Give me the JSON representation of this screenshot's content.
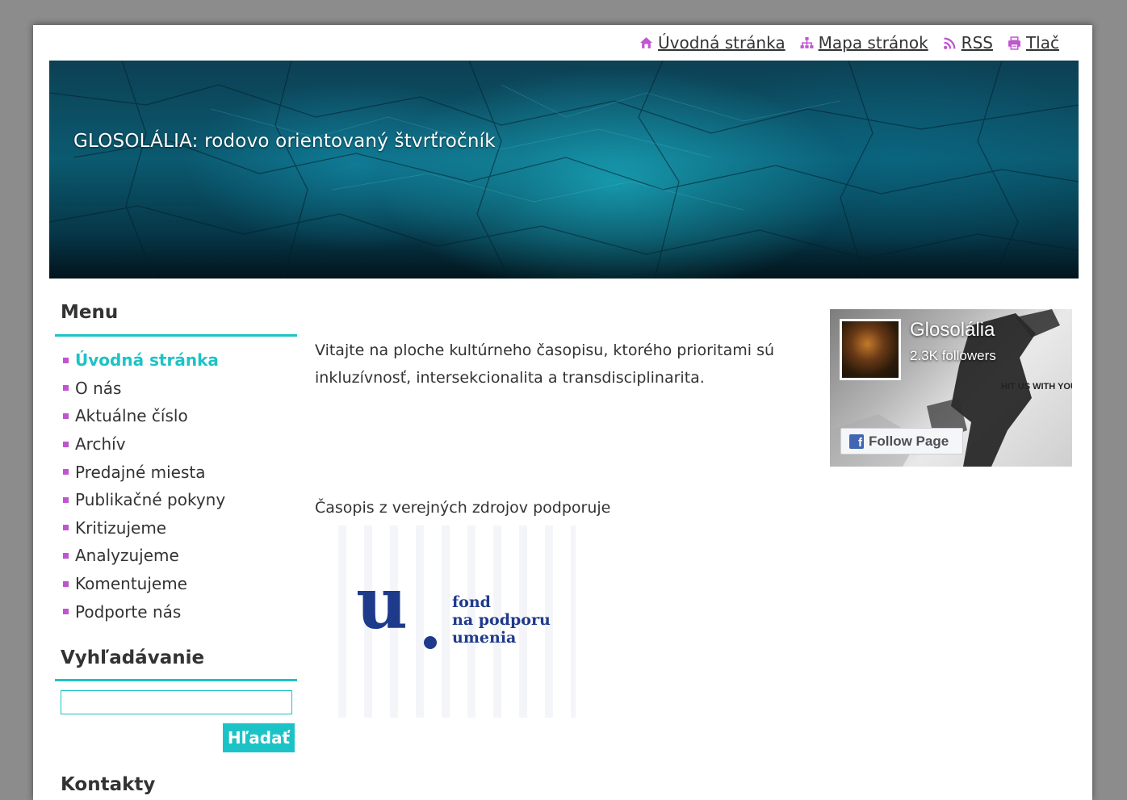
{
  "theme": {
    "accent": "#1cc3c6",
    "bullet": "#c055d0",
    "icon": "#c055d0",
    "text": "#333333",
    "fund_blue": "#1e3a8a",
    "facebook_blue": "#4267b2"
  },
  "top_nav": [
    {
      "label": "Úvodná stránka",
      "icon": "home-icon"
    },
    {
      "label": "Mapa stránok",
      "icon": "sitemap-icon"
    },
    {
      "label": "RSS",
      "icon": "rss-icon"
    },
    {
      "label": "Tlač",
      "icon": "print-icon"
    }
  ],
  "header": {
    "title": "GLOSOLÁLIA: rodovo orientovaný štvrťročník"
  },
  "sidebar": {
    "menu_heading": "Menu",
    "menu_items": [
      {
        "label": "Úvodná stránka",
        "active": true
      },
      {
        "label": "O nás",
        "active": false
      },
      {
        "label": "Aktuálne číslo",
        "active": false
      },
      {
        "label": "Archív",
        "active": false
      },
      {
        "label": "Predajné miesta",
        "active": false
      },
      {
        "label": "Publikačné pokyny",
        "active": false
      },
      {
        "label": "Kritizujeme",
        "active": false
      },
      {
        "label": "Analyzujeme",
        "active": false
      },
      {
        "label": "Komentujeme",
        "active": false
      },
      {
        "label": "Podporte nás",
        "active": false
      }
    ],
    "search_heading": "Vyhľadávanie",
    "search_value": "",
    "search_button": "Hľadať",
    "contacts_heading": "Kontakty"
  },
  "main": {
    "welcome_text": "Vitajte na ploche kultúrneho časopisu, ktorého prioritami sú inkluzívnosť, intersekcionalita a transdisciplinarita.",
    "support_text": "Časopis z verejných zdrojov podporuje",
    "fund_logo": {
      "letter": "u",
      "lines": [
        "fond",
        "na podporu",
        "umenia"
      ]
    }
  },
  "facebook": {
    "page_name": "Glosolália",
    "followers": "2.3K followers",
    "cover_text": "HIT US WITH YOU",
    "follow_label": "Follow Page",
    "f_glyph": "f"
  }
}
